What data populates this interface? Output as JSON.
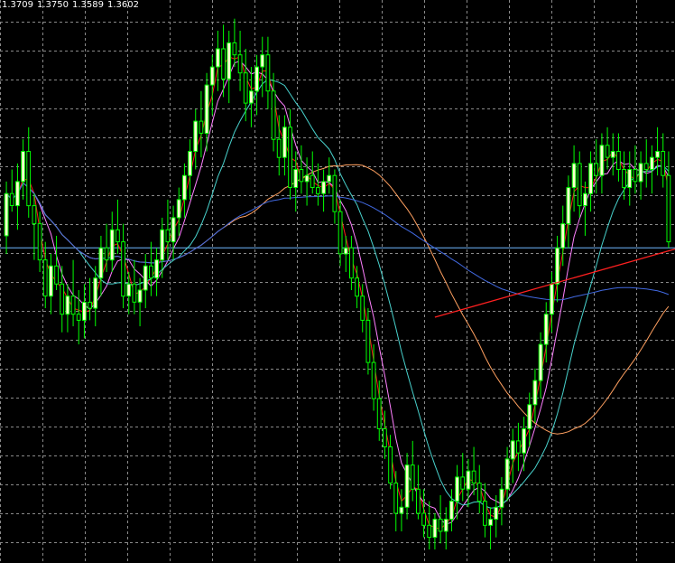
{
  "chart_data": {
    "type": "candlestick",
    "ohlc": {
      "open": "1.3709",
      "high": "1.3750",
      "low": "1.3589",
      "close": "1.3602"
    },
    "ylim": [
      1.29,
      1.379
    ],
    "grid": true,
    "colors": {
      "background": "#000000",
      "grid": "#8a8a8a",
      "bull_body": "#ffffd0",
      "bear_body": "#000000",
      "candle_outline": "#00ff00",
      "ma_fast": "#ff1a1a",
      "ma_medium": "#ff80ff",
      "ma_slow": "#48d1cc",
      "ma_long": "#ffa060",
      "ma_longest": "#4169e1",
      "horizontal_level": "#6fb7ff",
      "trendline": "#ff2020"
    },
    "horizontal_level": 1.34,
    "trendline": {
      "from_index": 77,
      "from_value": 1.3285,
      "to_index": 118,
      "to_value": 1.3398
    },
    "candles": [
      [
        1.342,
        1.351,
        1.339,
        1.349
      ],
      [
        1.349,
        1.353,
        1.346,
        1.347
      ],
      [
        1.347,
        1.354,
        1.343,
        1.351
      ],
      [
        1.351,
        1.358,
        1.348,
        1.356
      ],
      [
        1.356,
        1.36,
        1.345,
        1.347
      ],
      [
        1.347,
        1.349,
        1.338,
        1.344
      ],
      [
        1.344,
        1.346,
        1.336,
        1.338
      ],
      [
        1.338,
        1.341,
        1.33,
        1.332
      ],
      [
        1.332,
        1.339,
        1.329,
        1.337
      ],
      [
        1.337,
        1.342,
        1.333,
        1.334
      ],
      [
        1.334,
        1.337,
        1.326,
        1.329
      ],
      [
        1.329,
        1.334,
        1.326,
        1.332
      ],
      [
        1.332,
        1.338,
        1.327,
        1.329
      ],
      [
        1.329,
        1.333,
        1.324,
        1.328
      ],
      [
        1.328,
        1.334,
        1.325,
        1.331
      ],
      [
        1.331,
        1.335,
        1.328,
        1.33
      ],
      [
        1.33,
        1.337,
        1.327,
        1.335
      ],
      [
        1.335,
        1.342,
        1.332,
        1.34
      ],
      [
        1.34,
        1.344,
        1.336,
        1.338
      ],
      [
        1.338,
        1.346,
        1.336,
        1.343
      ],
      [
        1.343,
        1.348,
        1.339,
        1.341
      ],
      [
        1.341,
        1.344,
        1.33,
        1.332
      ],
      [
        1.332,
        1.336,
        1.329,
        1.334
      ],
      [
        1.334,
        1.338,
        1.329,
        1.331
      ],
      [
        1.331,
        1.335,
        1.327,
        1.333
      ],
      [
        1.333,
        1.339,
        1.33,
        1.337
      ],
      [
        1.337,
        1.341,
        1.332,
        1.335
      ],
      [
        1.335,
        1.34,
        1.332,
        1.338
      ],
      [
        1.338,
        1.345,
        1.335,
        1.343
      ],
      [
        1.343,
        1.348,
        1.338,
        1.341
      ],
      [
        1.341,
        1.347,
        1.338,
        1.345
      ],
      [
        1.345,
        1.35,
        1.342,
        1.348
      ],
      [
        1.348,
        1.354,
        1.345,
        1.352
      ],
      [
        1.352,
        1.358,
        1.348,
        1.356
      ],
      [
        1.356,
        1.363,
        1.353,
        1.361
      ],
      [
        1.361,
        1.366,
        1.355,
        1.359
      ],
      [
        1.359,
        1.369,
        1.356,
        1.367
      ],
      [
        1.367,
        1.372,
        1.362,
        1.37
      ],
      [
        1.37,
        1.376,
        1.366,
        1.373
      ],
      [
        1.373,
        1.377,
        1.365,
        1.368
      ],
      [
        1.368,
        1.376,
        1.364,
        1.374
      ],
      [
        1.374,
        1.378,
        1.37,
        1.372
      ],
      [
        1.372,
        1.376,
        1.366,
        1.369
      ],
      [
        1.369,
        1.373,
        1.361,
        1.364
      ],
      [
        1.364,
        1.37,
        1.36,
        1.366
      ],
      [
        1.366,
        1.372,
        1.362,
        1.37
      ],
      [
        1.37,
        1.375,
        1.365,
        1.372
      ],
      [
        1.372,
        1.375,
        1.363,
        1.366
      ],
      [
        1.366,
        1.369,
        1.356,
        1.358
      ],
      [
        1.358,
        1.362,
        1.352,
        1.355
      ],
      [
        1.355,
        1.362,
        1.352,
        1.36
      ],
      [
        1.36,
        1.363,
        1.348,
        1.35
      ],
      [
        1.35,
        1.356,
        1.346,
        1.353
      ],
      [
        1.353,
        1.357,
        1.349,
        1.351
      ],
      [
        1.351,
        1.355,
        1.347,
        1.352
      ],
      [
        1.352,
        1.356,
        1.349,
        1.35
      ],
      [
        1.35,
        1.354,
        1.347,
        1.349
      ],
      [
        1.349,
        1.353,
        1.346,
        1.351
      ],
      [
        1.351,
        1.355,
        1.349,
        1.352
      ],
      [
        1.352,
        1.353,
        1.344,
        1.346
      ],
      [
        1.346,
        1.348,
        1.337,
        1.339
      ],
      [
        1.339,
        1.342,
        1.336,
        1.34
      ],
      [
        1.34,
        1.342,
        1.333,
        1.335
      ],
      [
        1.335,
        1.337,
        1.33,
        1.332
      ],
      [
        1.332,
        1.334,
        1.326,
        1.328
      ],
      [
        1.328,
        1.33,
        1.319,
        1.321
      ],
      [
        1.321,
        1.324,
        1.313,
        1.315
      ],
      [
        1.315,
        1.318,
        1.308,
        1.31
      ],
      [
        1.31,
        1.313,
        1.305,
        1.307
      ],
      [
        1.307,
        1.309,
        1.3,
        1.301
      ],
      [
        1.301,
        1.303,
        1.293,
        1.296
      ],
      [
        1.296,
        1.3,
        1.293,
        1.297
      ],
      [
        1.297,
        1.306,
        1.295,
        1.304
      ],
      [
        1.304,
        1.308,
        1.298,
        1.3
      ],
      [
        1.3,
        1.304,
        1.295,
        1.296
      ],
      [
        1.296,
        1.3,
        1.292,
        1.294
      ],
      [
        1.294,
        1.298,
        1.29,
        1.292
      ],
      [
        1.292,
        1.296,
        1.29,
        1.295
      ],
      [
        1.295,
        1.299,
        1.291,
        1.293
      ],
      [
        1.293,
        1.297,
        1.29,
        1.295
      ],
      [
        1.295,
        1.3,
        1.293,
        1.298
      ],
      [
        1.298,
        1.304,
        1.295,
        1.302
      ],
      [
        1.302,
        1.306,
        1.298,
        1.3
      ],
      [
        1.3,
        1.305,
        1.297,
        1.303
      ],
      [
        1.303,
        1.307,
        1.299,
        1.301
      ],
      [
        1.301,
        1.304,
        1.296,
        1.298
      ],
      [
        1.298,
        1.301,
        1.292,
        1.294
      ],
      [
        1.294,
        1.297,
        1.29,
        1.295
      ],
      [
        1.295,
        1.299,
        1.292,
        1.297
      ],
      [
        1.297,
        1.302,
        1.294,
        1.3
      ],
      [
        1.3,
        1.307,
        1.298,
        1.305
      ],
      [
        1.305,
        1.31,
        1.301,
        1.308
      ],
      [
        1.308,
        1.311,
        1.303,
        1.306
      ],
      [
        1.306,
        1.312,
        1.303,
        1.31
      ],
      [
        1.31,
        1.316,
        1.307,
        1.314
      ],
      [
        1.314,
        1.32,
        1.311,
        1.318
      ],
      [
        1.318,
        1.326,
        1.315,
        1.324
      ],
      [
        1.324,
        1.331,
        1.321,
        1.329
      ],
      [
        1.329,
        1.336,
        1.326,
        1.334
      ],
      [
        1.334,
        1.342,
        1.331,
        1.34
      ],
      [
        1.34,
        1.347,
        1.337,
        1.344
      ],
      [
        1.344,
        1.352,
        1.34,
        1.35
      ],
      [
        1.35,
        1.357,
        1.346,
        1.354
      ],
      [
        1.354,
        1.356,
        1.345,
        1.347
      ],
      [
        1.347,
        1.351,
        1.342,
        1.349
      ],
      [
        1.349,
        1.356,
        1.346,
        1.354
      ],
      [
        1.354,
        1.358,
        1.349,
        1.352
      ],
      [
        1.352,
        1.359,
        1.349,
        1.357
      ],
      [
        1.357,
        1.36,
        1.353,
        1.355
      ],
      [
        1.355,
        1.359,
        1.352,
        1.356
      ],
      [
        1.356,
        1.359,
        1.351,
        1.353
      ],
      [
        1.353,
        1.356,
        1.348,
        1.35
      ],
      [
        1.35,
        1.356,
        1.347,
        1.353
      ],
      [
        1.353,
        1.357,
        1.349,
        1.351
      ],
      [
        1.351,
        1.356,
        1.348,
        1.354
      ],
      [
        1.354,
        1.358,
        1.35,
        1.353
      ],
      [
        1.353,
        1.357,
        1.349,
        1.355
      ],
      [
        1.355,
        1.36,
        1.352,
        1.356
      ],
      [
        1.356,
        1.359,
        1.35,
        1.352
      ],
      [
        1.352,
        1.356,
        1.34,
        1.341
      ]
    ],
    "moving_averages": [
      {
        "color_key": "ma_fast",
        "period": 3
      },
      {
        "color_key": "ma_medium",
        "period": 6
      },
      {
        "color_key": "ma_slow",
        "period": 14
      },
      {
        "color_key": "ma_long",
        "period": 40
      },
      {
        "color_key": "ma_longest",
        "period": 80
      }
    ]
  }
}
